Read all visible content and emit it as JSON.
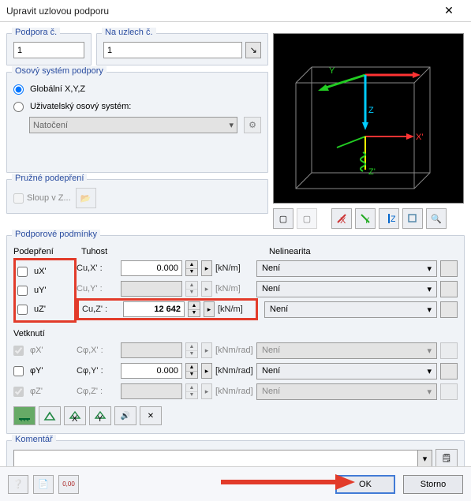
{
  "title": "Upravit uzlovou podporu",
  "support_no": {
    "label": "Podpora č.",
    "value": "1"
  },
  "on_nodes": {
    "label": "Na uzlech č.",
    "value": "1"
  },
  "axis_group": {
    "title": "Osový systém podpory",
    "global": "Globální X,Y,Z",
    "user": "Uživatelský osový systém:",
    "rotation": "Natočení"
  },
  "spring_group": {
    "title": "Pružné podepření",
    "column": "Sloup v Z..."
  },
  "cond_group": {
    "title": "Podporové podmínky",
    "restraint": "Podepření",
    "stiffness": "Tuhost",
    "nonlinear": "Nelinearita",
    "rotation_h": "Vetknutí"
  },
  "rows": {
    "ux": {
      "chk": "uX'",
      "lab": "Cu,X' :",
      "val": "0.000",
      "unit": "[kN/m]",
      "nl": "Není"
    },
    "uy": {
      "chk": "uY'",
      "lab": "Cu,Y' :",
      "val": "",
      "unit": "[kN/m]",
      "nl": "Není"
    },
    "uz": {
      "chk": "uZ'",
      "lab": "Cu,Z' :",
      "val": "12 642",
      "unit": "[kN/m]",
      "nl": "Není"
    },
    "fx": {
      "chk": "φX'",
      "lab": "Cφ,X' :",
      "val": "",
      "unit": "[kNm/rad]",
      "nl": "Není"
    },
    "fy": {
      "chk": "φY'",
      "lab": "Cφ,Y' :",
      "val": "0.000",
      "unit": "[kNm/rad]",
      "nl": "Není"
    },
    "fz": {
      "chk": "φZ'",
      "lab": "Cφ,Z' :",
      "val": "",
      "unit": "[kNm/rad]",
      "nl": "Není"
    }
  },
  "comment": {
    "title": "Komentář",
    "value": ""
  },
  "buttons": {
    "ok": "OK",
    "cancel": "Storno"
  }
}
